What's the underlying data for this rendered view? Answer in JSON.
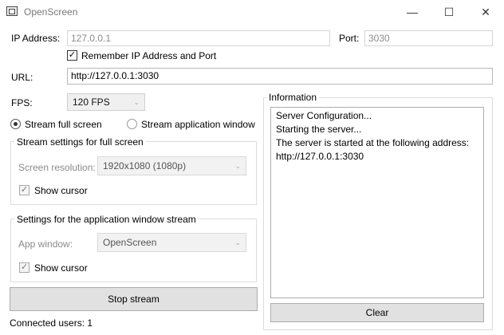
{
  "window": {
    "title": "OpenScreen",
    "minimize_glyph": "—",
    "maximize_glyph": "☐",
    "close_glyph": "✕"
  },
  "connection": {
    "ip_label": "IP Address:",
    "ip_value": "127.0.0.1",
    "port_label": "Port:",
    "port_value": "3030",
    "remember_label": "Remember IP Address and Port",
    "remember_checked": true,
    "url_label": "URL:",
    "url_value": "http://127.0.0.1:3030"
  },
  "fps": {
    "label": "FPS:",
    "value": "120 FPS"
  },
  "mode": {
    "full_screen_label": "Stream full screen",
    "app_window_label": "Stream application window",
    "selected": "full_screen"
  },
  "fullscreen_group": {
    "title": "Stream settings for full screen",
    "resolution_label": "Screen resolution:",
    "resolution_value": "1920x1080 (1080p)",
    "show_cursor_label": "Show cursor",
    "show_cursor_checked": true
  },
  "appwindow_group": {
    "title": "Settings for the application window stream",
    "app_window_label": "App window:",
    "app_window_value": "OpenScreen",
    "show_cursor_label": "Show cursor",
    "show_cursor_checked": true
  },
  "actions": {
    "stop_stream_label": "Stop stream",
    "clear_label": "Clear"
  },
  "status": {
    "connected_users": "Connected users: 1"
  },
  "information": {
    "title": "Information",
    "lines": [
      "Server Configuration...",
      "Starting the server...",
      "The server is started at the following address:",
      "http://127.0.0.1:3030"
    ]
  },
  "icons": {
    "app": "app-icon",
    "check_glyph": "✓",
    "dropdown_glyph": "⌄"
  }
}
